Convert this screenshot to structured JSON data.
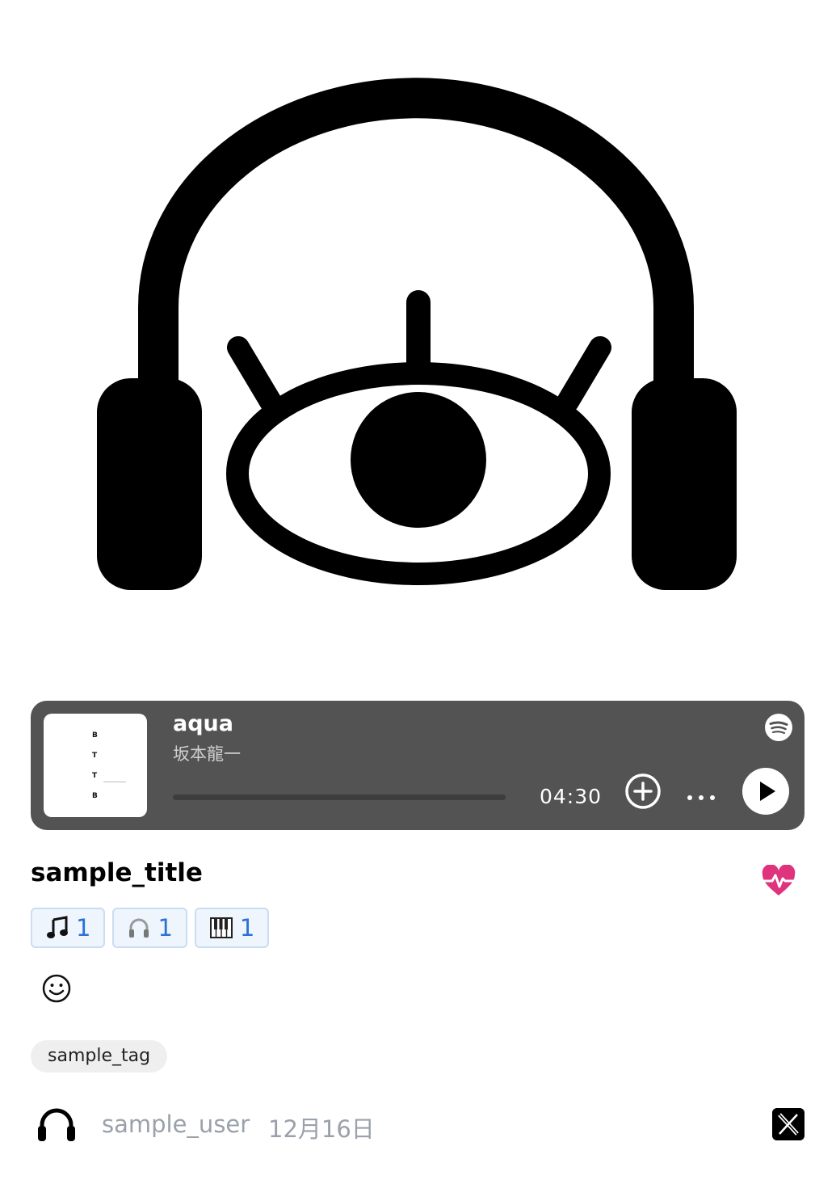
{
  "player": {
    "cover_letters": [
      "B",
      "T",
      "T",
      "B"
    ],
    "title": "aqua",
    "artist": "坂本龍一",
    "duration": "04:30",
    "service_icon": "spotify-icon",
    "progress": 0
  },
  "post": {
    "title": "sample_title",
    "counters": [
      {
        "icon": "music-note-icon",
        "count": "1"
      },
      {
        "icon": "headphones-icon",
        "count": "1"
      },
      {
        "icon": "piano-icon",
        "count": "1"
      }
    ],
    "tag": "sample_tag"
  },
  "footer": {
    "username": "sample_user",
    "date": "12月16日"
  },
  "colors": {
    "player_bg": "#535353",
    "heart": "#e0337d",
    "counter_text": "#2a72d4",
    "muted_text": "#9aa1ab"
  }
}
